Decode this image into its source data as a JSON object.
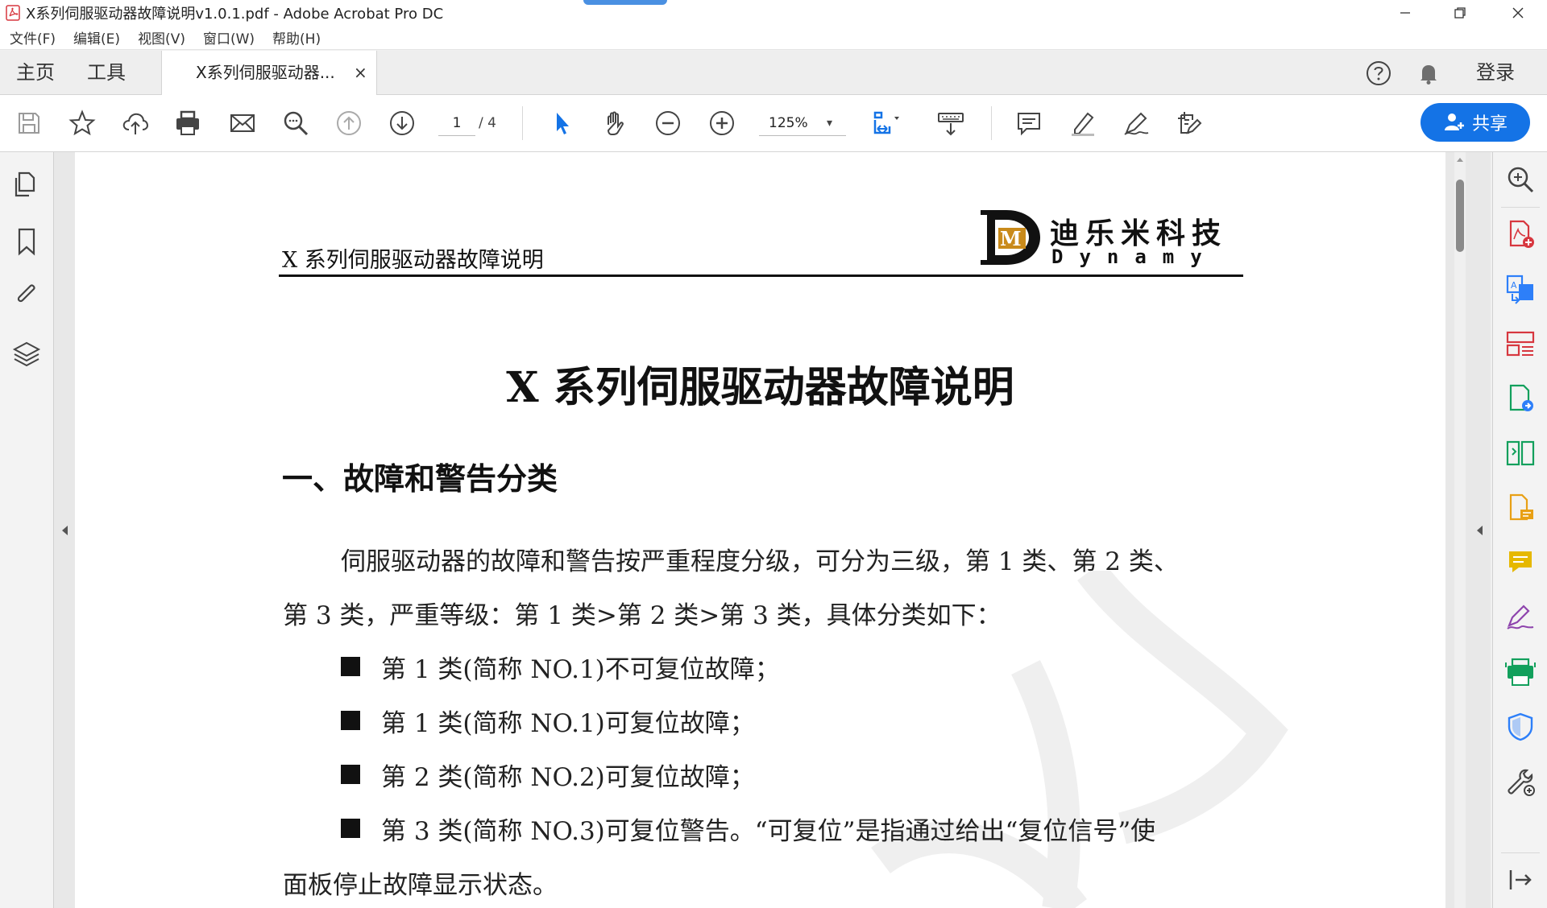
{
  "window": {
    "title": "X系列伺服驱动器故障说明v1.0.1.pdf - Adobe Acrobat Pro DC",
    "minimize": "─",
    "restore": "❐",
    "close": "✕"
  },
  "menu": {
    "file": "文件(F)",
    "edit": "编辑(E)",
    "view": "视图(V)",
    "window": "窗口(W)",
    "help": "帮助(H)"
  },
  "tabs": {
    "home": "主页",
    "tools": "工具",
    "document": "X系列伺服驱动器...",
    "close": "×",
    "login": "登录"
  },
  "toolbar": {
    "page_current": "1",
    "page_total": "/ 4",
    "zoom": "125%",
    "zoom_arrow": "▾",
    "share": "共享"
  },
  "document": {
    "header_title": "X 系列伺服驱动器故障说明",
    "logo_cn": "迪乐米科技",
    "logo_en": "Dynamy",
    "logo_letters": "DM",
    "title": "X 系列伺服驱动器故障说明",
    "section1": "一、故障和警告分类",
    "para1_line1": "伺服驱动器的故障和警告按严重程度分级，可分为三级，第 1 类、第 2 类、",
    "para1_line2": "第 3 类，严重等级：第 1 类>第 2 类>第 3 类，具体分类如下：",
    "bullets": [
      "第 1 类(简称 NO.1)不可复位故障；",
      "第 1 类(简称 NO.1)可复位故障；",
      "第 2 类(简称 NO.2)可复位故障；",
      "第 3 类(简称 NO.3)可复位警告。“可复位”是指通过给出“复位信号”使"
    ],
    "last_line": "面板停止故障显示状态。"
  },
  "colors": {
    "accent": "#1473e6",
    "pdf_red": "#d7373f",
    "right_blue": "#2d7ff9",
    "right_green": "#12a05c",
    "right_orange": "#e8a015",
    "right_yellow": "#e6b800",
    "right_purple": "#8e44ad"
  }
}
